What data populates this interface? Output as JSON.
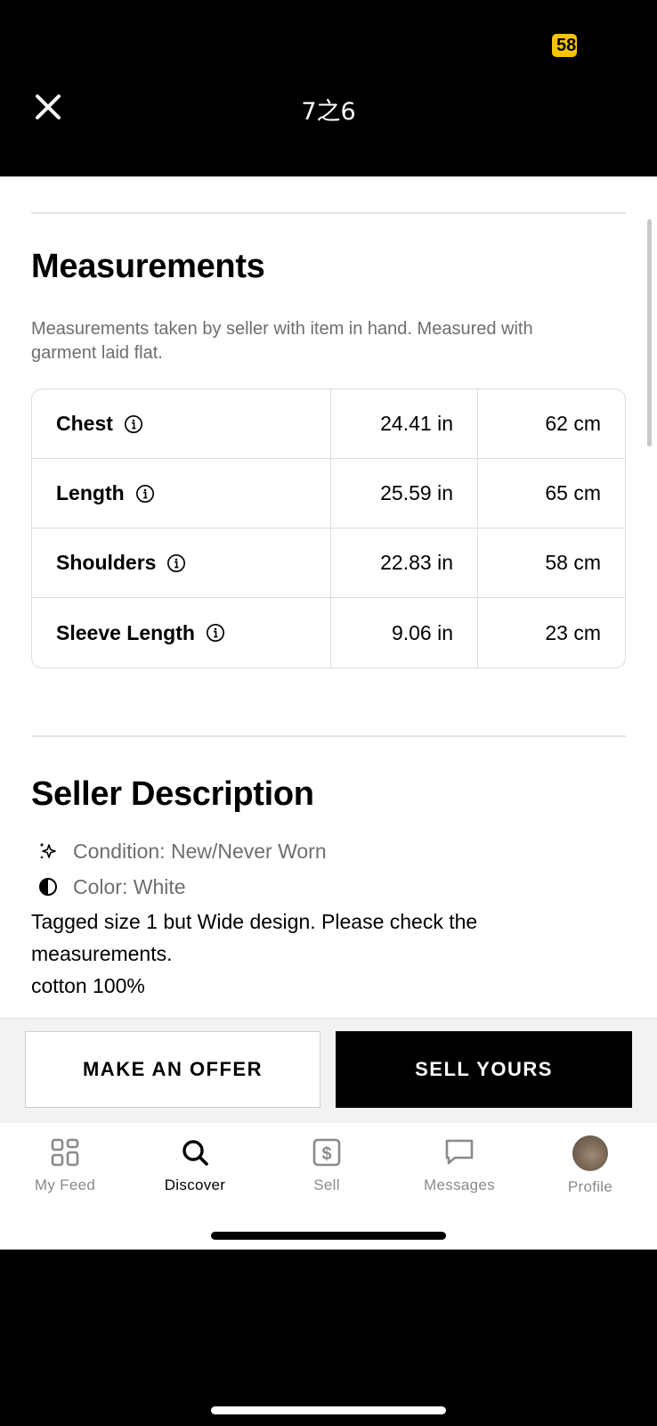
{
  "topbar": {
    "counter": "7之6",
    "status_badge": "58"
  },
  "measurements": {
    "title": "Measurements",
    "note": "Measurements taken by seller with item in hand. Measured with garment laid flat.",
    "rows": [
      {
        "label": "Chest",
        "in": "24.41 in",
        "cm": "62 cm"
      },
      {
        "label": "Length",
        "in": "25.59 in",
        "cm": "65 cm"
      },
      {
        "label": "Shoulders",
        "in": "22.83 in",
        "cm": "58 cm"
      },
      {
        "label": "Sleeve Length",
        "in": "9.06 in",
        "cm": "23 cm"
      }
    ]
  },
  "seller_description": {
    "title": "Seller Description",
    "condition": "Condition: New/Never Worn",
    "color": "Color: White",
    "text_lines": [
      "Tagged size 1 but Wide design. Please check the",
      "measurements.",
      "cotton 100%"
    ]
  },
  "actions": {
    "offer_label": "MAKE AN OFFER",
    "sell_label": "SELL YOURS"
  },
  "tabs": [
    {
      "label": "My Feed",
      "icon": "grid-icon"
    },
    {
      "label": "Discover",
      "icon": "search-icon"
    },
    {
      "label": "Sell",
      "icon": "dollar-tag-icon"
    },
    {
      "label": "Messages",
      "icon": "message-icon"
    },
    {
      "label": "Profile",
      "icon": "avatar"
    }
  ],
  "colors": {
    "badge": "#f5c400",
    "primary_button": "#000000",
    "muted_text": "#6e6e6e"
  }
}
